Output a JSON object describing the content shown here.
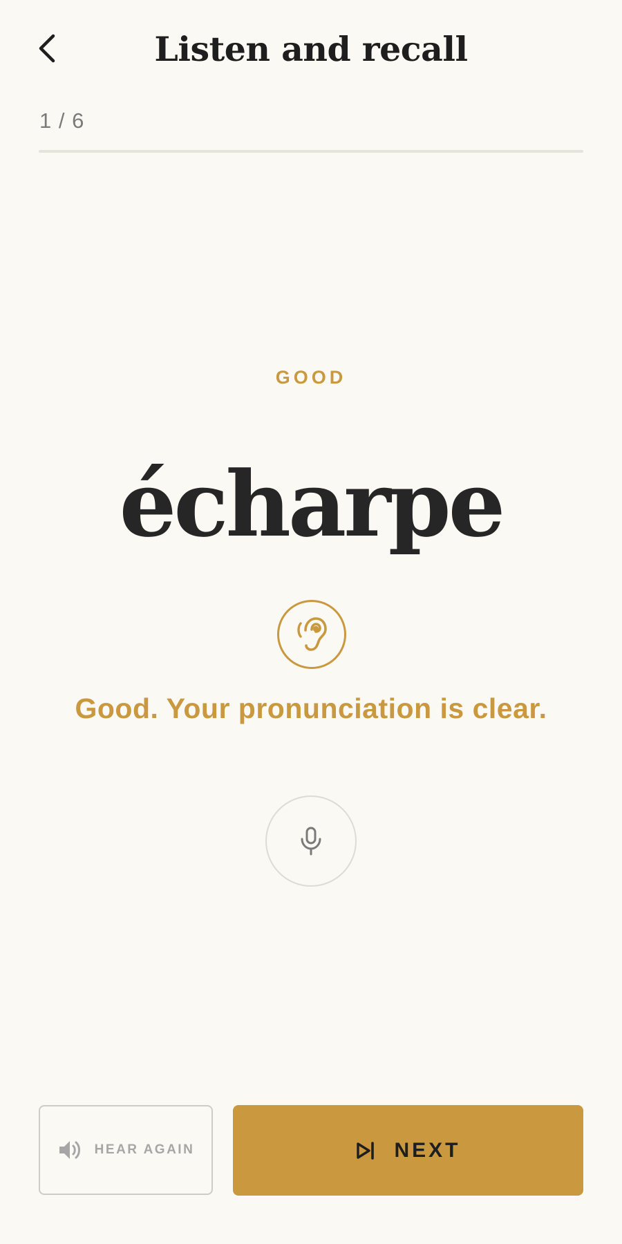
{
  "header": {
    "title": "Listen and recall",
    "back_icon": "chevron-left-icon"
  },
  "progress": {
    "current": 1,
    "total": 6,
    "label": "1 / 6",
    "fraction": 0.0
  },
  "card": {
    "rating": "GOOD",
    "word": "écharpe",
    "badge_icon": "ear-icon",
    "feedback": "Good. Your pronunciation is clear.",
    "mic_icon": "microphone-icon"
  },
  "actions": {
    "hear_again_label": "HEAR AGAIN",
    "hear_again_icon": "speaker-icon",
    "next_label": "NEXT",
    "next_icon": "skip-next-icon"
  },
  "colors": {
    "background": "#fbf9f4",
    "accent": "#c9983f",
    "text": "#262626",
    "muted": "#7a7a7a"
  }
}
